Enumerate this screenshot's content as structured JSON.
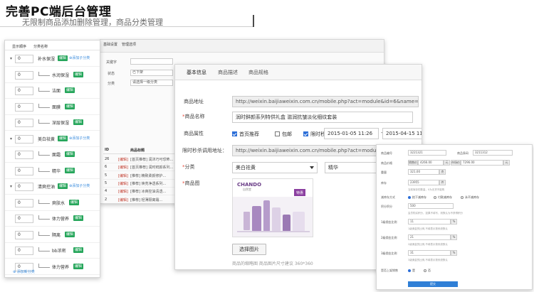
{
  "hero": {
    "title": "完善PC端后台管理",
    "subtitle": "无限制商品添加删除管理，商品分类管理"
  },
  "tree": {
    "header": {
      "order": "显示顺序",
      "name": "分类名称"
    },
    "rows": [
      {
        "order": "0",
        "name": "补水保湿",
        "level": 1,
        "tag": "编辑",
        "add": "添加子分类",
        "chevron": "▾"
      },
      {
        "order": "0",
        "name": "水润保湿",
        "level": 2,
        "tag": "编辑"
      },
      {
        "order": "0",
        "name": "洁面",
        "level": 2,
        "tag": "编辑"
      },
      {
        "order": "0",
        "name": "面膜",
        "level": 2,
        "tag": "编辑"
      },
      {
        "order": "0",
        "name": "深层保湿",
        "level": 2,
        "tag": "编辑"
      },
      {
        "order": "0",
        "name": "美白祛黄",
        "level": 1,
        "tag": "编辑",
        "add": "添加子分类",
        "chevron": "▾"
      },
      {
        "order": "0",
        "name": "面霜",
        "level": 2,
        "tag": "编辑"
      },
      {
        "order": "0",
        "name": "精华",
        "level": 2,
        "tag": "编辑"
      },
      {
        "order": "0",
        "name": "清爽控油",
        "level": 1,
        "tag": "编辑",
        "add": "添加子分类",
        "chevron": "▾"
      },
      {
        "order": "0",
        "name": "爽肤水",
        "level": 2,
        "tag": "编辑"
      },
      {
        "order": "0",
        "name": "体力营养",
        "level": 2,
        "tag": "编辑"
      },
      {
        "order": "0",
        "name": "隔离",
        "level": 2,
        "tag": "编辑"
      },
      {
        "order": "0",
        "name": "bb浓密",
        "level": 2,
        "tag": "编辑"
      },
      {
        "order": "0",
        "name": "体力营养",
        "level": 2,
        "tag": "编辑"
      }
    ],
    "add_category": "添加新分类"
  },
  "list_panel": {
    "tabs": [
      "基础设置",
      "管理选项"
    ],
    "filters": {
      "keyword_label": "关键字",
      "status_label": "状态",
      "status_value": "已下架",
      "category_label": "分类",
      "category_value": "请选择一级分类"
    },
    "columns": [
      "ID",
      "商品标题"
    ],
    "rows": [
      {
        "id": "26",
        "tag": "[编辑]",
        "text": "[首页推荐] 润沐巧可恐怖..."
      },
      {
        "id": "6",
        "tag": "[编辑]",
        "text": "[首页推荐] 润时鲜颜系列..."
      },
      {
        "id": "5",
        "tag": "[编辑]",
        "text": "[推荐] 精致柔颜修护..."
      },
      {
        "id": "5",
        "tag": "[编辑]",
        "text": "[推荐] 焕亮净透系列..."
      },
      {
        "id": "4",
        "tag": "[编辑]",
        "text": "[推荐] 冰爽控油清透..."
      },
      {
        "id": "2",
        "tag": "[编辑]",
        "text": "[推荐] 轻薄隔离霜..."
      },
      {
        "id": "1",
        "tag": "[编辑]",
        "text": "[推荐] 水润保湿精华..."
      },
      {
        "id": "5",
        "tag": "[编辑]",
        "text": "[推荐] 平衡爽肤水..."
      },
      {
        "id": "1",
        "tag": "[编辑]",
        "text": "[推荐] 深层洁面乳..."
      }
    ],
    "submit": "提交"
  },
  "edit": {
    "tabs": [
      "基本信息",
      "商品描述",
      "商品规格"
    ],
    "labels": {
      "url": "商品地址",
      "name": "商品名称",
      "attr": "商品属性",
      "flash_url": "限时秒杀调用地址：",
      "category": "分类",
      "image": "商品图"
    },
    "url_value": "http://weixin.baijiaweixin.com.cn/mobile.php?act=module&id=6&name=",
    "name_value": "润时鲜颜系列特供礼盒 滋润抗皱淡化细纹套装",
    "attr_options": [
      {
        "label": "首页推荐",
        "checked": true
      },
      {
        "label": "包邮",
        "checked": false
      },
      {
        "label": "限时秒杀",
        "checked": true
      }
    ],
    "date_start": "2015-01-05 11:26",
    "date_sep": "-",
    "date_end": "2015-04-15 11:25",
    "flash_url_value": "http://weixin.baijiaweixin.com.cn/mobile.php?act=module&id=",
    "category_primary": "美白祛黄",
    "category_secondary": "精华",
    "choose_image": "选择图片",
    "image_hint": "商品的缩略图 商品图片尺寸建议 360*360",
    "brand_text": "CHANDO",
    "brand_sub": "自然堂",
    "badge": "特惠"
  },
  "detail": {
    "fields": [
      {
        "label": "商品编号",
        "value": "3221321"
      },
      {
        "label": "商品条码",
        "value": "3211312"
      },
      {
        "label": "商品价格",
        "unit_label": "销售价",
        "value": "4266.00",
        "unit2": "元",
        "label2": "市场价",
        "value2": "7296.00",
        "unit3": "元"
      },
      {
        "label": "重量",
        "value": "321.00",
        "unit": "克"
      },
      {
        "label": "库存",
        "value": "23955",
        "unit": "件"
      }
    ],
    "stock_hint": "当前库存的数量，0为无货不能购",
    "reduce_label": "减库存方式",
    "reduce_options": [
      "拍下减库存",
      "付款减库存",
      "永不减库存"
    ],
    "points_label": "积分积分",
    "points_value": "500",
    "points_hint": "会员购买积分，如果不填写，则默认为不获得积分",
    "commission": [
      {
        "label": "1级佣金比例",
        "value": "11",
        "unit": "%"
      },
      {
        "label": "2级佣金比例",
        "value": "21",
        "unit": "%"
      },
      {
        "label": "3级佣金比例",
        "value": "31",
        "unit": "%"
      }
    ],
    "commission_hint1": "1级佣金的比例,不填表示按系统默认",
    "commission_hint2": "2级佣金的比例,不填表示按系统默认",
    "commission_hint3": "3级佣金的比例,不填表示按系统默认",
    "onsale_label": "是否上架销售",
    "onsale_options": [
      "是",
      "否"
    ],
    "submit": "提交"
  },
  "colors": {
    "accent": "#3c8dde",
    "tag_green": "#26a65b",
    "submit_blue": "#2f7fd6"
  }
}
